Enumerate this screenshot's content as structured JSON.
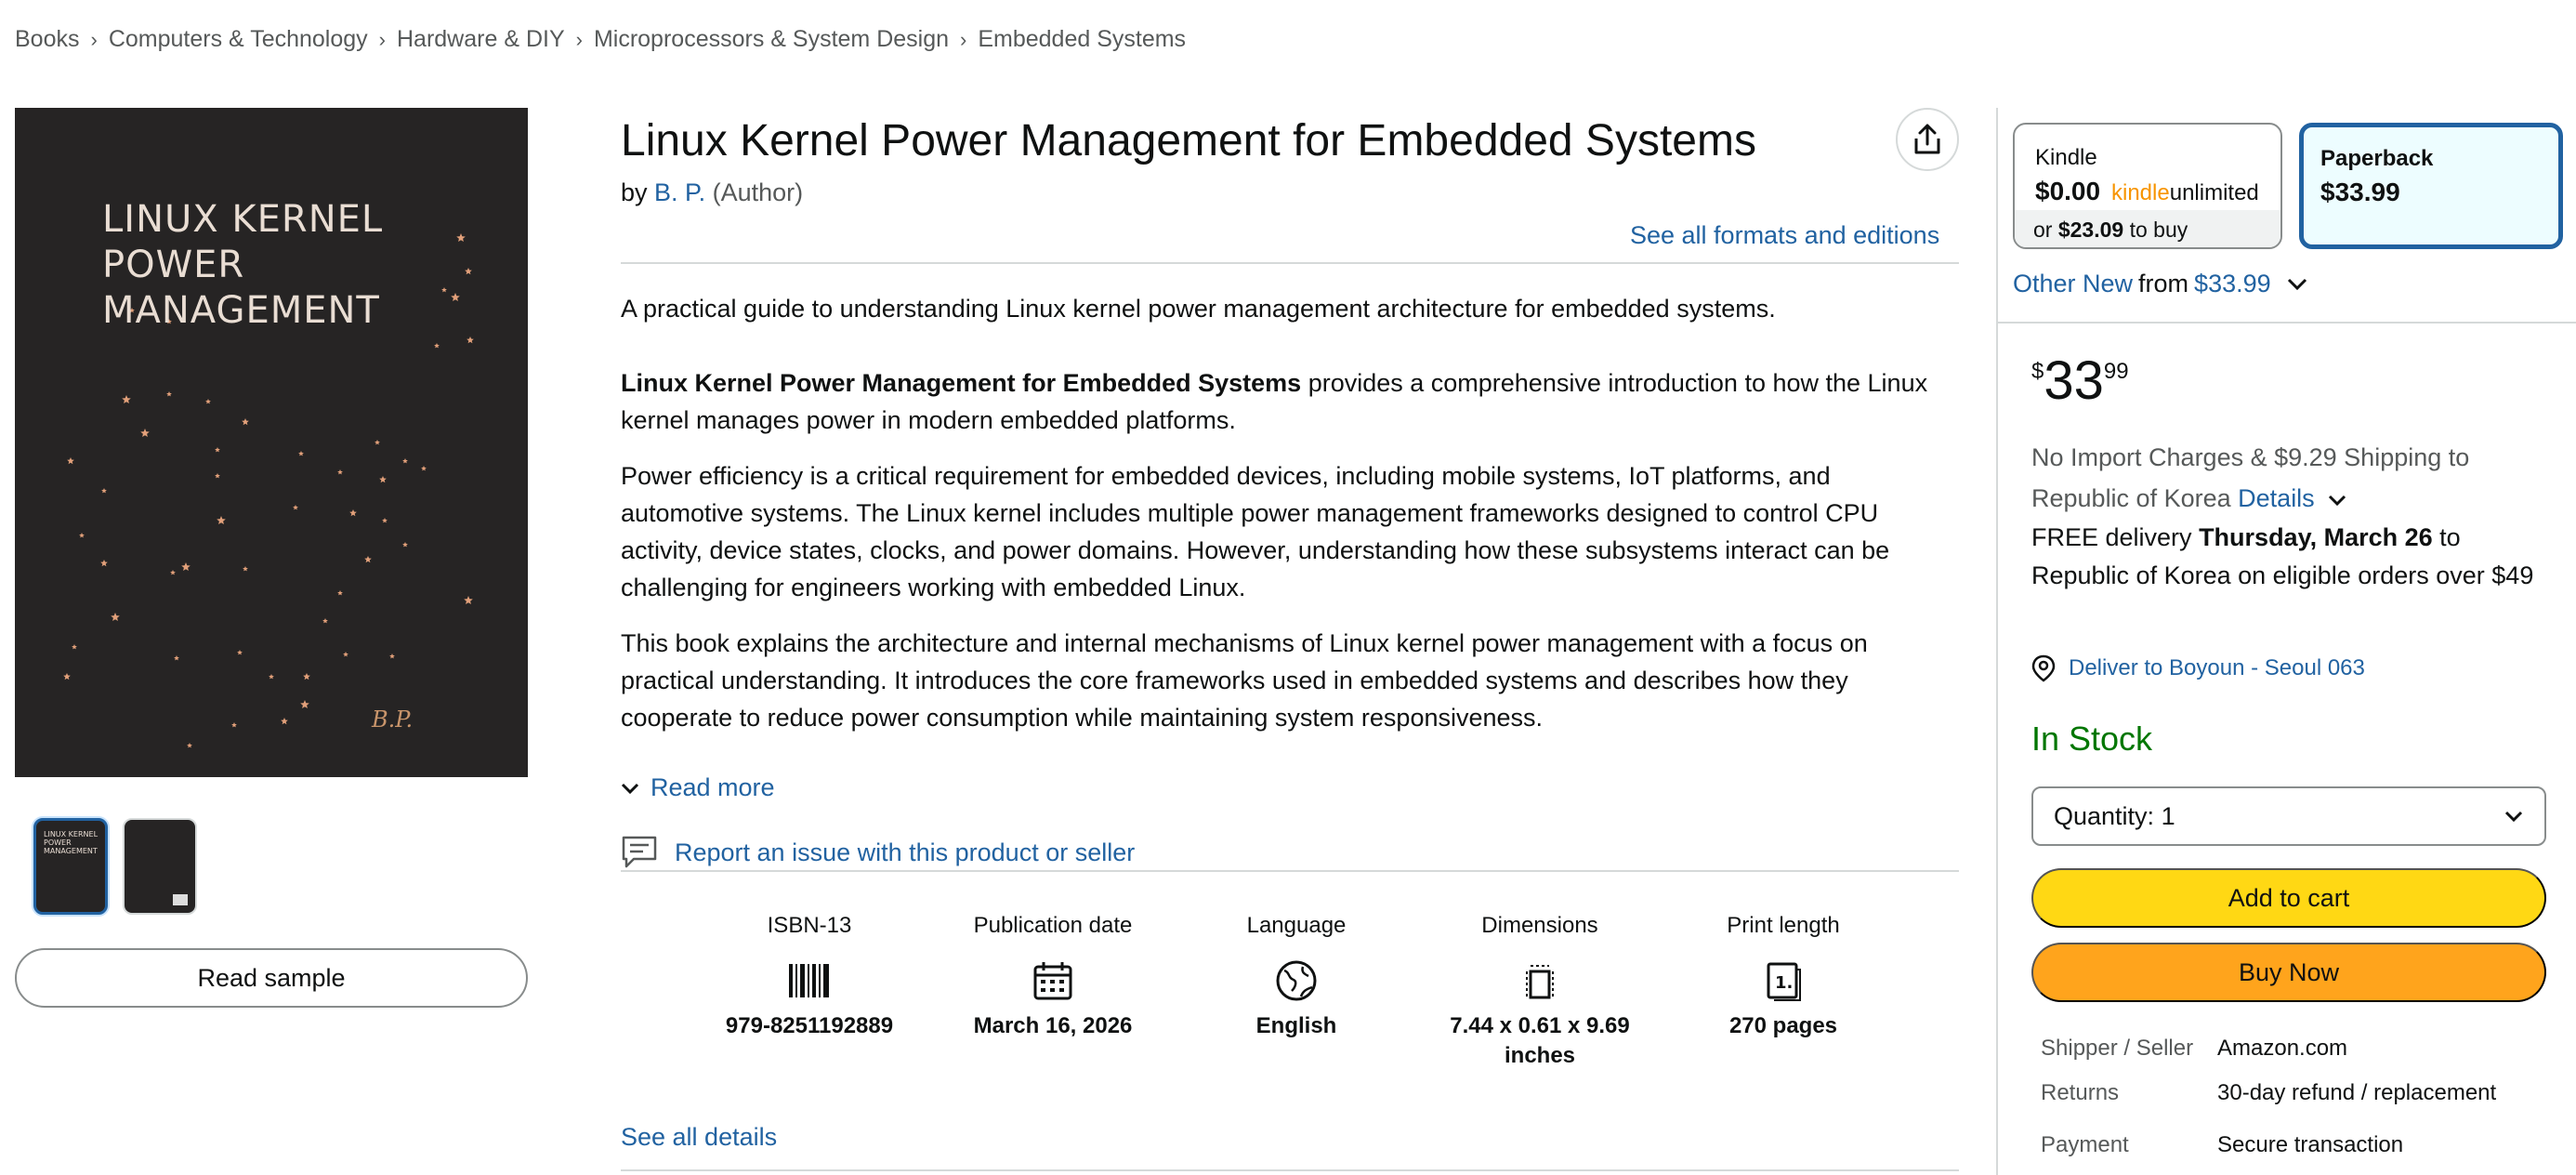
{
  "breadcrumb": [
    "Books",
    "Computers & Technology",
    "Hardware & DIY",
    "Microprocessors & System Design",
    "Embedded Systems"
  ],
  "cover": {
    "title_lines": [
      "LINUX KERNEL",
      "POWER",
      "MANAGEMENT"
    ],
    "author": "B.P.",
    "background": "#262424",
    "star_color": "#e2a07a"
  },
  "thumb_text": "LINUX KERNEL POWER MANAGEMENT",
  "read_sample": "Read sample",
  "product": {
    "title": "Linux Kernel Power Management for Embedded Systems",
    "by": "by",
    "author": "B. P.",
    "role": "(Author)",
    "formats_link": "See all formats and editions"
  },
  "description": {
    "intro": "A practical guide to understanding Linux kernel power management architecture for embedded systems.",
    "p1_bold": "Linux Kernel Power Management for Embedded Systems",
    "p1_rest": " provides a comprehensive introduction to how the Linux kernel manages power in modern embedded platforms.",
    "p2": "Power efficiency is a critical requirement for embedded devices, including mobile systems, IoT platforms, and automotive systems. The Linux kernel includes multiple power management frameworks designed to control CPU activity, device states, clocks, and power domains. However, understanding how these subsystems interact can be challenging for engineers working with embedded Linux.",
    "p3": "This book explains the architecture and internal mechanisms of Linux kernel power management with a focus on practical understanding. It introduces the core frameworks used in embedded systems and describes how they cooperate to reduce power consumption while maintaining system responsiveness.",
    "read_more": "Read more"
  },
  "report_issue": "Report an issue with this product or seller",
  "details": [
    {
      "label": "ISBN-13",
      "value": "979-8251192889",
      "icon": "barcode-icon"
    },
    {
      "label": "Publication date",
      "value": "March 16, 2026",
      "icon": "calendar-icon"
    },
    {
      "label": "Language",
      "value": "English",
      "icon": "globe-icon"
    },
    {
      "label": "Dimensions",
      "value": "7.44 x 0.61 x 9.69 inches",
      "icon": "dimensions-icon"
    },
    {
      "label": "Print length",
      "value": "270 pages",
      "icon": "pages-icon"
    }
  ],
  "see_all_details": "See all details",
  "formats": {
    "kindle": {
      "name": "Kindle",
      "price": "$0.00",
      "ku_a": "kindle",
      "ku_b": "unlimited",
      "alt_prefix": "or",
      "alt_price": "$23.09",
      "alt_suffix": "to buy"
    },
    "paperback": {
      "name": "Paperback",
      "price": "$33.99"
    }
  },
  "other_new": {
    "label": "Other New",
    "from": "from",
    "price": "$33.99"
  },
  "buybox": {
    "currency": "$",
    "whole": "33",
    "fraction": "99",
    "import_text": "No Import Charges & $9.29 Shipping to Republic of Korea",
    "details_link": "Details",
    "delivery_prefix": "FREE delivery",
    "delivery_date": "Thursday, March 26",
    "delivery_suffix": "to Republic of Korea on eligible orders over $49",
    "deliver_to": "Deliver to Boyoun - Seoul 063",
    "stock": "In Stock",
    "quantity_label": "Quantity:",
    "quantity_value": "1",
    "add_to_cart": "Add to cart",
    "buy_now": "Buy Now",
    "rows": [
      {
        "k": "Shipper / Seller",
        "v": "Amazon.com",
        "link": false
      },
      {
        "k": "Returns",
        "v": "30-day refund / replacement",
        "link": true
      },
      {
        "k": "Payment",
        "v": "Secure transaction",
        "link": true
      }
    ]
  },
  "colors": {
    "link": "#2162a1",
    "stock": "#007600",
    "cart": "#ffd814",
    "buy": "#ffa41c",
    "selected_border": "#2162a1"
  }
}
